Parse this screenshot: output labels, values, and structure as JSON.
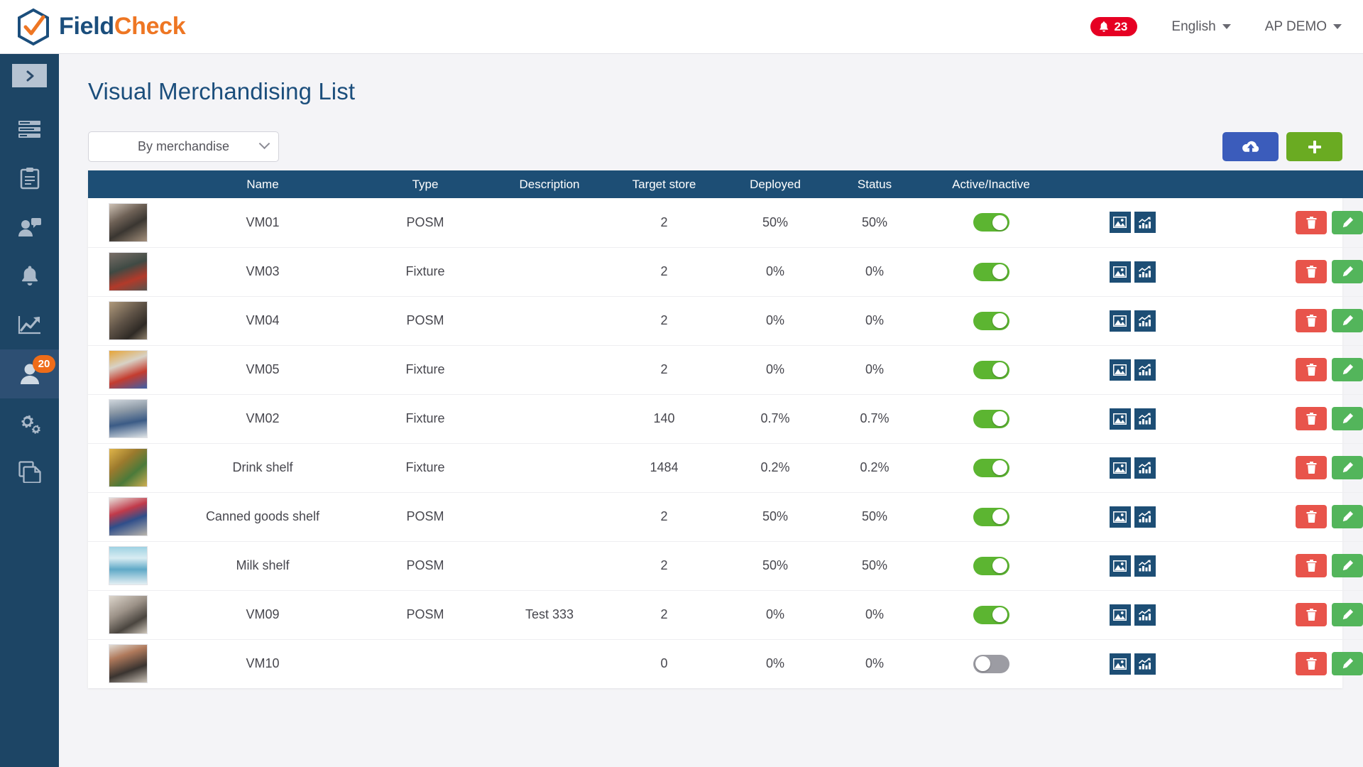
{
  "brand": {
    "name_first": "Field",
    "name_second": "Check",
    "color_primary": "#1b4e7c",
    "color_accent": "#ee7623",
    "logo_icon": "hexagon-check-icon"
  },
  "topbar": {
    "notifications": {
      "icon": "bell-icon",
      "count": "23",
      "color": "#e60023"
    },
    "language": {
      "label": "English",
      "icon": "chevron-down-icon"
    },
    "account": {
      "label": "AP DEMO",
      "icon": "chevron-down-icon"
    }
  },
  "sidebar": {
    "background": "#1d4565",
    "toggle": {
      "icon": "chevron-right-icon"
    },
    "items": [
      {
        "icon": "list-rows-icon",
        "active": false,
        "badge": ""
      },
      {
        "icon": "clipboard-icon",
        "active": false,
        "badge": ""
      },
      {
        "icon": "person-message-icon",
        "active": false,
        "badge": ""
      },
      {
        "icon": "bell-icon",
        "active": false,
        "badge": ""
      },
      {
        "icon": "chart-trend-icon",
        "active": false,
        "badge": ""
      },
      {
        "icon": "person-icon",
        "active": true,
        "badge": "20"
      },
      {
        "icon": "gears-icon",
        "active": false,
        "badge": ""
      },
      {
        "icon": "documents-icon",
        "active": false,
        "badge": ""
      }
    ]
  },
  "page": {
    "title": "Visual Merchandising List"
  },
  "toolbar": {
    "filter": {
      "value": "By merchandise",
      "icon": "chevron-down-icon"
    },
    "upload_button": {
      "icon": "cloud-upload-icon",
      "color": "#3b5cbb"
    },
    "add_button": {
      "icon": "plus-icon",
      "color": "#6aab22"
    }
  },
  "table": {
    "header_color": "#1d4e75",
    "columns": [
      {
        "key": "thumb",
        "label": ""
      },
      {
        "key": "name",
        "label": "Name"
      },
      {
        "key": "type",
        "label": "Type"
      },
      {
        "key": "desc",
        "label": "Description"
      },
      {
        "key": "target",
        "label": "Target store"
      },
      {
        "key": "deploy",
        "label": "Deployed"
      },
      {
        "key": "status",
        "label": "Status"
      },
      {
        "key": "toggle",
        "label": "Active/Inactive"
      },
      {
        "key": "icons",
        "label": ""
      },
      {
        "key": "spacer",
        "label": ""
      },
      {
        "key": "act",
        "label": ""
      }
    ],
    "rows": [
      {
        "name": "VM01",
        "type": "POSM",
        "description": "",
        "target_store": "2",
        "deployed": "50%",
        "status": "50%",
        "active": true
      },
      {
        "name": "VM03",
        "type": "Fixture",
        "description": "",
        "target_store": "2",
        "deployed": "0%",
        "status": "0%",
        "active": true
      },
      {
        "name": "VM04",
        "type": "POSM",
        "description": "",
        "target_store": "2",
        "deployed": "0%",
        "status": "0%",
        "active": true
      },
      {
        "name": "VM05",
        "type": "Fixture",
        "description": "",
        "target_store": "2",
        "deployed": "0%",
        "status": "0%",
        "active": true
      },
      {
        "name": "VM02",
        "type": "Fixture",
        "description": "",
        "target_store": "140",
        "deployed": "0.7%",
        "status": "0.7%",
        "active": true
      },
      {
        "name": "Drink shelf",
        "type": "Fixture",
        "description": "",
        "target_store": "1484",
        "deployed": "0.2%",
        "status": "0.2%",
        "active": true
      },
      {
        "name": "Canned goods shelf",
        "type": "POSM",
        "description": "",
        "target_store": "2",
        "deployed": "50%",
        "status": "50%",
        "active": true
      },
      {
        "name": "Milk shelf",
        "type": "POSM",
        "description": "",
        "target_store": "2",
        "deployed": "50%",
        "status": "50%",
        "active": true
      },
      {
        "name": "VM09",
        "type": "POSM",
        "description": "Test 333",
        "target_store": "2",
        "deployed": "0%",
        "status": "0%",
        "active": true
      },
      {
        "name": "VM10",
        "type": "",
        "description": "",
        "target_store": "0",
        "deployed": "0%",
        "status": "0%",
        "active": false
      }
    ],
    "row_actions": {
      "image_icon": "image-icon",
      "chart_icon": "bar-chart-icon",
      "delete_icon": "trash-icon",
      "edit_icon": "pencil-icon",
      "delete_color": "#e8544b",
      "edit_color": "#53b55b"
    }
  }
}
